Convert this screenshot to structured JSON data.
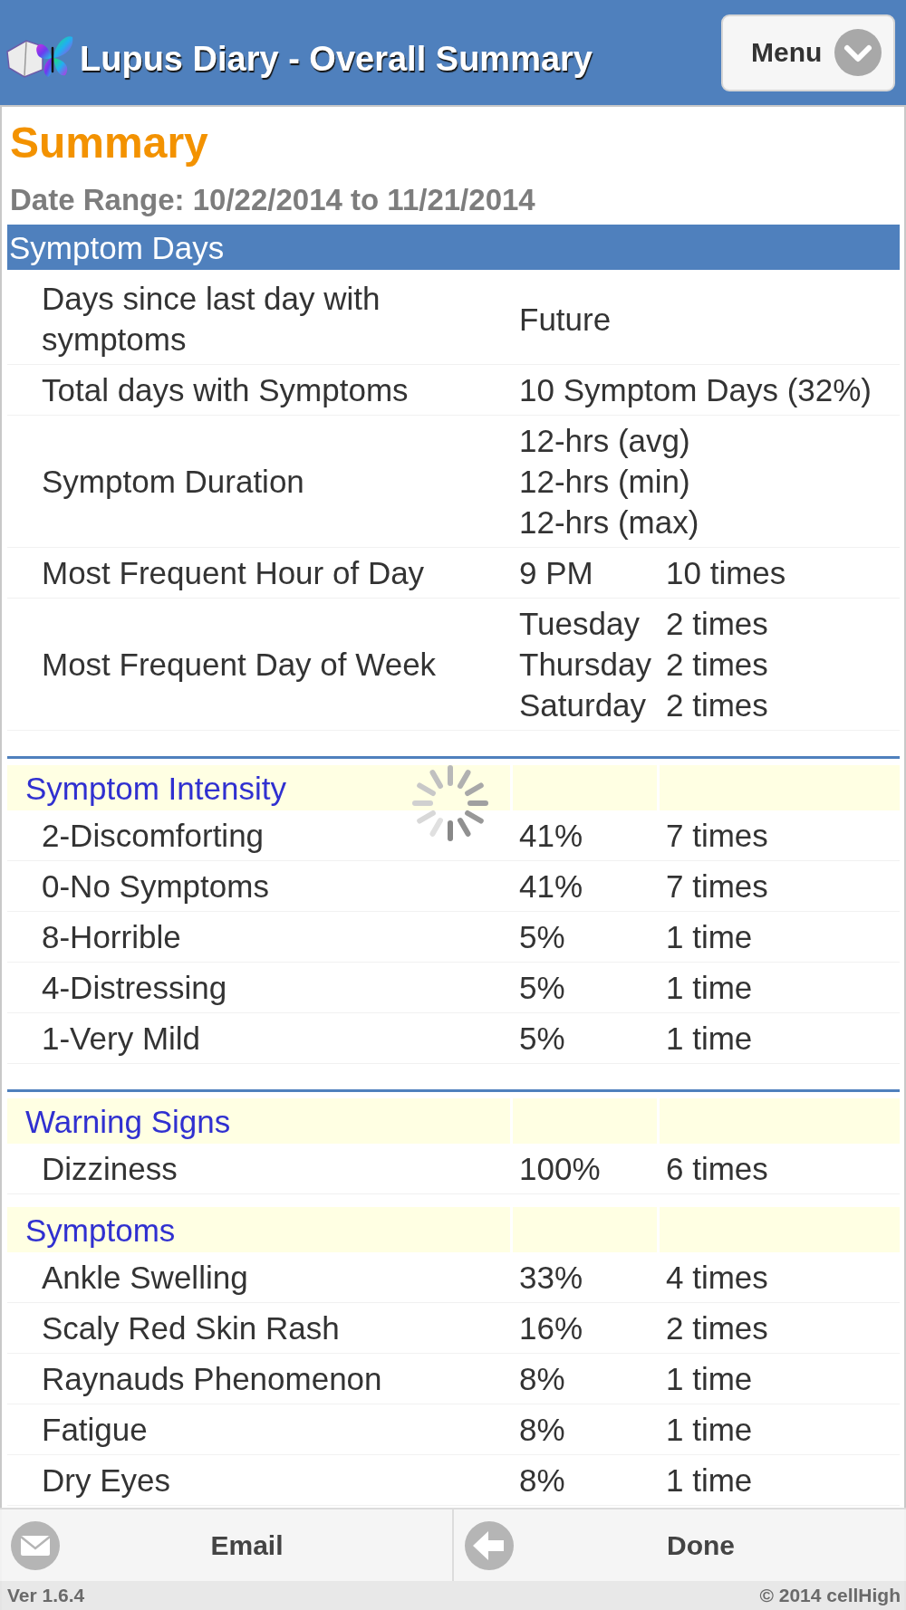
{
  "header": {
    "title": "Lupus Diary - Overall Summary",
    "menu_button": "Menu"
  },
  "summary": {
    "heading": "Summary",
    "date_range": "Date Range: 10/22/2014 to 11/21/2014"
  },
  "sections": [
    {
      "kind": "banner",
      "title": "Symptom Days",
      "divider_after": true,
      "rows": [
        {
          "label": "Days since last day with symptoms",
          "cells": [
            [
              "Future"
            ]
          ]
        },
        {
          "label": "Total days with Symptoms",
          "cells": [
            [
              "10 Symptom Days (32%)"
            ]
          ]
        },
        {
          "label": "Symptom Duration",
          "cells": [
            [
              "12-hrs (avg)",
              "12-hrs (min)",
              "12-hrs (max)"
            ]
          ]
        },
        {
          "label": "Most Frequent Hour of Day",
          "cells": [
            [
              "9 PM"
            ],
            [
              "10 times"
            ]
          ]
        },
        {
          "label": "Most Frequent Day of Week",
          "cells": [
            [
              "Tuesday",
              "Thursday",
              "Saturday"
            ],
            [
              "2 times",
              "2 times",
              "2 times"
            ]
          ]
        }
      ]
    },
    {
      "kind": "group",
      "title": "Symptom Intensity",
      "divider_after": true,
      "rows": [
        {
          "label": "2-Discomforting",
          "cells": [
            [
              "41%"
            ],
            [
              "7 times"
            ]
          ]
        },
        {
          "label": "0-No Symptoms",
          "cells": [
            [
              "41%"
            ],
            [
              "7 times"
            ]
          ]
        },
        {
          "label": "8-Horrible",
          "cells": [
            [
              "5%"
            ],
            [
              "1 time"
            ]
          ]
        },
        {
          "label": "4-Distressing",
          "cells": [
            [
              "5%"
            ],
            [
              "1 time"
            ]
          ]
        },
        {
          "label": "1-Very Mild",
          "cells": [
            [
              "5%"
            ],
            [
              "1 time"
            ]
          ]
        }
      ]
    },
    {
      "kind": "group",
      "title": "Warning Signs",
      "divider_after": false,
      "rows": [
        {
          "label": "Dizziness",
          "cells": [
            [
              "100%"
            ],
            [
              "6 times"
            ]
          ]
        }
      ]
    },
    {
      "kind": "group",
      "title": "Symptoms",
      "divider_after": false,
      "rows": [
        {
          "label": "Ankle Swelling",
          "cells": [
            [
              "33%"
            ],
            [
              "4 times"
            ]
          ]
        },
        {
          "label": "Scaly Red Skin Rash",
          "cells": [
            [
              "16%"
            ],
            [
              "2 times"
            ]
          ]
        },
        {
          "label": "Raynauds Phenomenon",
          "cells": [
            [
              "8%"
            ],
            [
              "1 time"
            ]
          ]
        },
        {
          "label": "Fatigue",
          "cells": [
            [
              "8%"
            ],
            [
              "1 time"
            ]
          ]
        },
        {
          "label": "Dry Eyes",
          "cells": [
            [
              "8%"
            ],
            [
              "1 time"
            ]
          ]
        }
      ]
    }
  ],
  "footer": {
    "buttons": [
      {
        "kind": "email",
        "label": "Email"
      },
      {
        "kind": "done",
        "label": "Done"
      }
    ],
    "version": "Ver 1.6.4",
    "copyright": "© 2014 cellHigh"
  }
}
